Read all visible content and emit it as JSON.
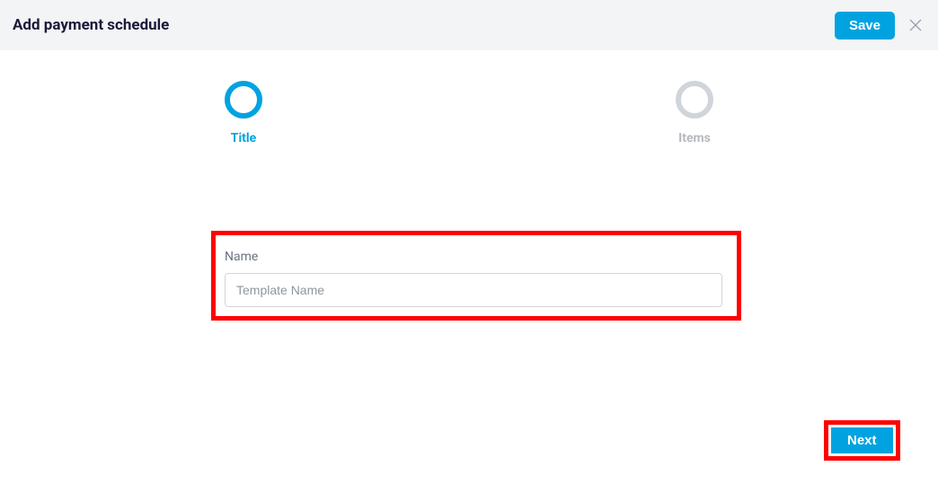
{
  "header": {
    "title": "Add payment schedule",
    "save_label": "Save"
  },
  "stepper": {
    "steps": [
      {
        "label": "Title",
        "state": "active"
      },
      {
        "label": "Items",
        "state": "inactive"
      }
    ]
  },
  "form": {
    "name_label": "Name",
    "name_placeholder": "Template Name",
    "name_value": ""
  },
  "footer": {
    "next_label": "Next"
  },
  "colors": {
    "accent": "#00a3e0",
    "highlight": "#ff0000"
  }
}
